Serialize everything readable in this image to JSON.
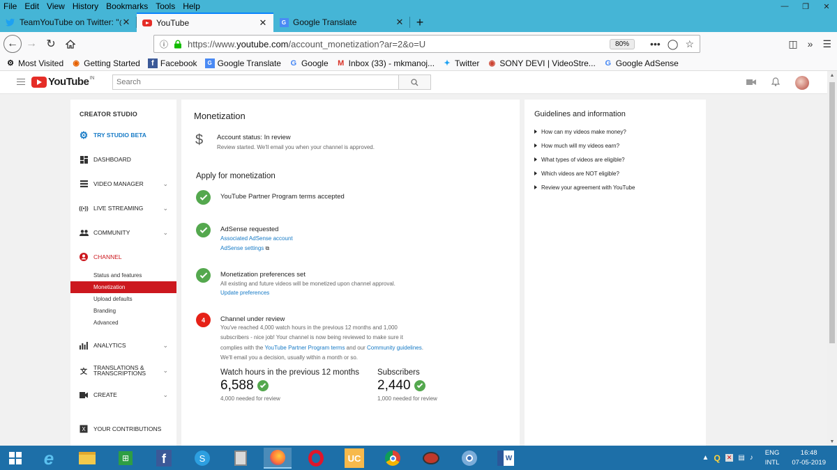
{
  "browser": {
    "menu": [
      "File",
      "Edit",
      "View",
      "History",
      "Bookmarks",
      "Tools",
      "Help"
    ],
    "tabs": [
      {
        "title": "TeamYouTube on Twitter: \"@S",
        "close": "✕"
      },
      {
        "title": "YouTube",
        "close": "✕"
      },
      {
        "title": "Google Translate",
        "close": "✕"
      }
    ],
    "newtab": "+",
    "url_prefix": "https://www.",
    "url_host": "youtube.com",
    "url_path": "/account_monetization?ar=2&o=U",
    "zoom": "80%",
    "bookmarks": [
      "Most Visited",
      "Getting Started",
      "Facebook",
      "Google Translate",
      "Google",
      "Inbox (33) - mkmanoj...",
      "Twitter",
      "SONY DEVI | VideoStre...",
      "Google AdSense"
    ]
  },
  "youtube": {
    "logo_text": "YouTube",
    "country": "IN",
    "search_placeholder": "Search"
  },
  "sidebar": {
    "heading": "CREATOR STUDIO",
    "items": [
      {
        "label": "TRY STUDIO BETA",
        "icon": "gear-icon"
      },
      {
        "label": "DASHBOARD",
        "icon": "dashboard-icon"
      },
      {
        "label": "VIDEO MANAGER",
        "icon": "list-icon"
      },
      {
        "label": "LIVE STREAMING",
        "icon": "broadcast-icon"
      },
      {
        "label": "COMMUNITY",
        "icon": "people-icon"
      },
      {
        "label": "CHANNEL",
        "icon": "person-icon"
      },
      {
        "label": "ANALYTICS",
        "icon": "bar-chart-icon"
      },
      {
        "label": "TRANSLATIONS &",
        "label2": "TRANSCRIPTIONS",
        "icon": "translate-icon"
      },
      {
        "label": "CREATE",
        "icon": "video-camera-icon"
      },
      {
        "label": "YOUR CONTRIBUTIONS",
        "icon": "contributions-icon"
      }
    ],
    "channel_sub": [
      "Status and features",
      "Monetization",
      "Upload defaults",
      "Branding",
      "Advanced"
    ]
  },
  "main": {
    "title": "Monetization",
    "status_label": "Account status: In review",
    "status_sub": "Review started. We'll email you when your channel is approved.",
    "apply_title": "Apply for monetization",
    "step1": "YouTube Partner Program terms accepted",
    "step2": "AdSense requested",
    "step2_link1": "Associated AdSense account",
    "step2_link2": "AdSense settings",
    "step3": "Monetization preferences set",
    "step3_desc": "All existing and future videos will be monetized upon channel approval.",
    "step3_link": "Update preferences",
    "step4_num": "4",
    "step4": "Channel under review",
    "step4_line1": "You've reached 4,000 watch hours in the previous 12 months and 1,000",
    "step4_line2": "subscribers - nice job! Your channel is now being reviewed to make sure it",
    "step4_line3a": "complies with the ",
    "step4_link_ypp": "YouTube Partner Program terms",
    "step4_line3b": " and our ",
    "step4_link_cg": "Community guidelines",
    "step4_line3c": ".",
    "step4_line4": "We'll email you a decision, usually within a month or so.",
    "watch_label": "Watch hours in the previous 12 months",
    "watch_value": "6,588",
    "watch_note": "4,000 needed for review",
    "subs_label": "Subscribers",
    "subs_value": "2,440",
    "subs_note": "1,000 needed for review"
  },
  "guide": {
    "title": "Guidelines and information",
    "links": [
      "How can my videos make money?",
      "How much will my videos earn?",
      "What types of videos are eligible?",
      "Which videos are NOT eligible?",
      "Review your agreement with YouTube"
    ]
  },
  "taskbar": {
    "lang1": "ENG",
    "lang2": "INTL",
    "time": "16:48",
    "date": "07-05-2019"
  }
}
